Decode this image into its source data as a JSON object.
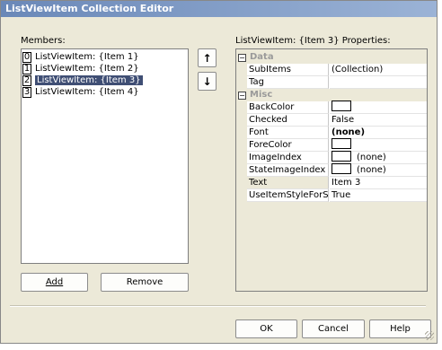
{
  "window": {
    "title": "ListViewItem Collection Editor"
  },
  "members": {
    "label": "Members:",
    "items": [
      {
        "index": "0",
        "text": "ListViewItem: {Item 1}",
        "selected": false
      },
      {
        "index": "1",
        "text": "ListViewItem: {Item 2}",
        "selected": false
      },
      {
        "index": "2",
        "text": "ListViewItem: {Item 3}",
        "selected": true
      },
      {
        "index": "3",
        "text": "ListViewItem: {Item 4}",
        "selected": false
      }
    ],
    "add_label": "Add",
    "remove_label": "Remove"
  },
  "properties": {
    "header_prefix": "ListViewItem: {Item 3} ",
    "header_suffix": "Properties:",
    "categories": [
      {
        "name": "Data",
        "toggle": "−",
        "props": [
          {
            "name": "SubItems",
            "value": "(Collection)"
          },
          {
            "name": "Tag",
            "value": ""
          }
        ]
      },
      {
        "name": "Misc",
        "toggle": "−",
        "props": [
          {
            "name": "BackColor",
            "value": "",
            "swatch": true
          },
          {
            "name": "Checked",
            "value": "False"
          },
          {
            "name": "Font",
            "value": "(none)",
            "bold": true
          },
          {
            "name": "ForeColor",
            "value": "",
            "swatch": true
          },
          {
            "name": "ImageIndex",
            "value": "(none)",
            "swatch": true
          },
          {
            "name": "StateImageIndex",
            "value": "(none)",
            "swatch": true
          },
          {
            "name": "Text",
            "value": "Item 3",
            "selected": true
          },
          {
            "name": "UseItemStyleForS",
            "value": "True"
          }
        ]
      }
    ]
  },
  "footer": {
    "ok_label": "OK",
    "cancel_label": "Cancel",
    "help_label": "Help"
  },
  "icons": {
    "up": "arrow-up-icon",
    "down": "arrow-down-icon"
  },
  "colors": {
    "selection": "#3f4e74",
    "titlebar": "#6a88b8",
    "dialog_bg": "#ece9d8"
  }
}
